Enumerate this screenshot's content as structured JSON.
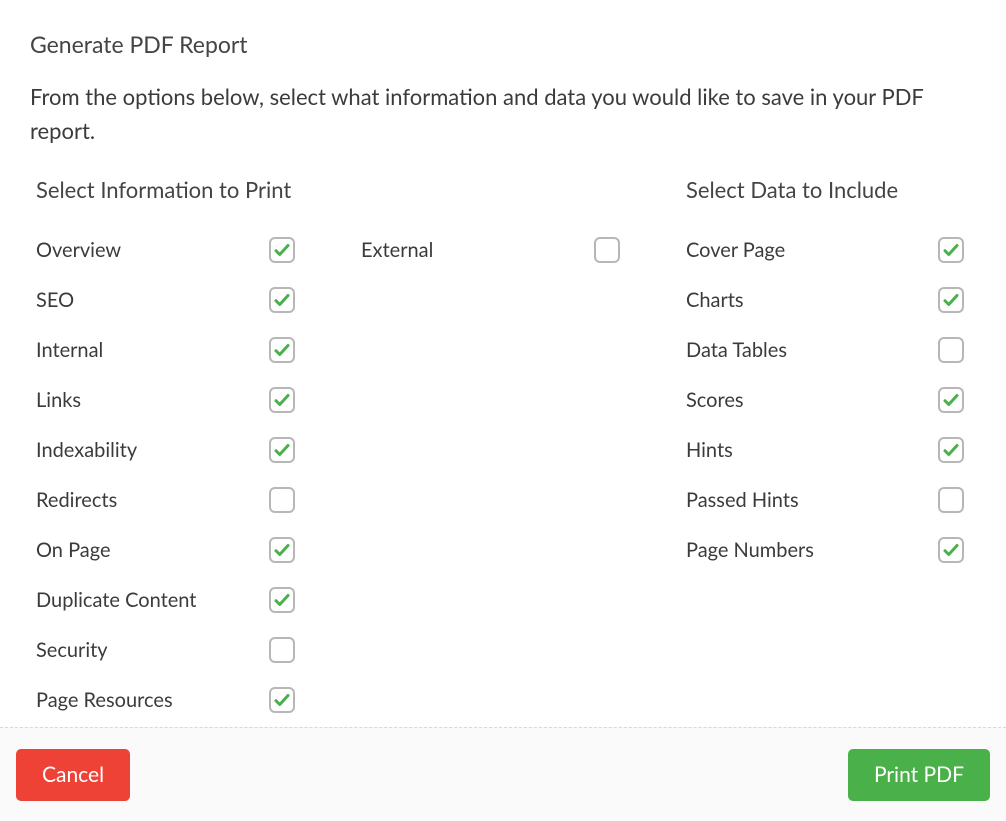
{
  "dialog": {
    "title": "Generate PDF Report",
    "description": "From the options below, select what information and data you would like to save in your PDF report."
  },
  "info_section": {
    "title": "Select Information to Print",
    "items_col1": [
      {
        "label": "Overview",
        "checked": true
      },
      {
        "label": "SEO",
        "checked": true
      },
      {
        "label": "Internal",
        "checked": true
      },
      {
        "label": "Links",
        "checked": true
      },
      {
        "label": "Indexability",
        "checked": true
      },
      {
        "label": "Redirects",
        "checked": false
      },
      {
        "label": "On Page",
        "checked": true
      },
      {
        "label": "Duplicate Content",
        "checked": true
      },
      {
        "label": "Security",
        "checked": false
      },
      {
        "label": "Page Resources",
        "checked": true
      }
    ],
    "items_col2": [
      {
        "label": "External",
        "checked": false
      }
    ]
  },
  "data_section": {
    "title": "Select Data to Include",
    "items": [
      {
        "label": "Cover Page",
        "checked": true
      },
      {
        "label": "Charts",
        "checked": true
      },
      {
        "label": "Data Tables",
        "checked": false
      },
      {
        "label": "Scores",
        "checked": true
      },
      {
        "label": "Hints",
        "checked": true
      },
      {
        "label": "Passed Hints",
        "checked": false
      },
      {
        "label": "Page Numbers",
        "checked": true
      }
    ]
  },
  "buttons": {
    "cancel": "Cancel",
    "print": "Print PDF"
  }
}
